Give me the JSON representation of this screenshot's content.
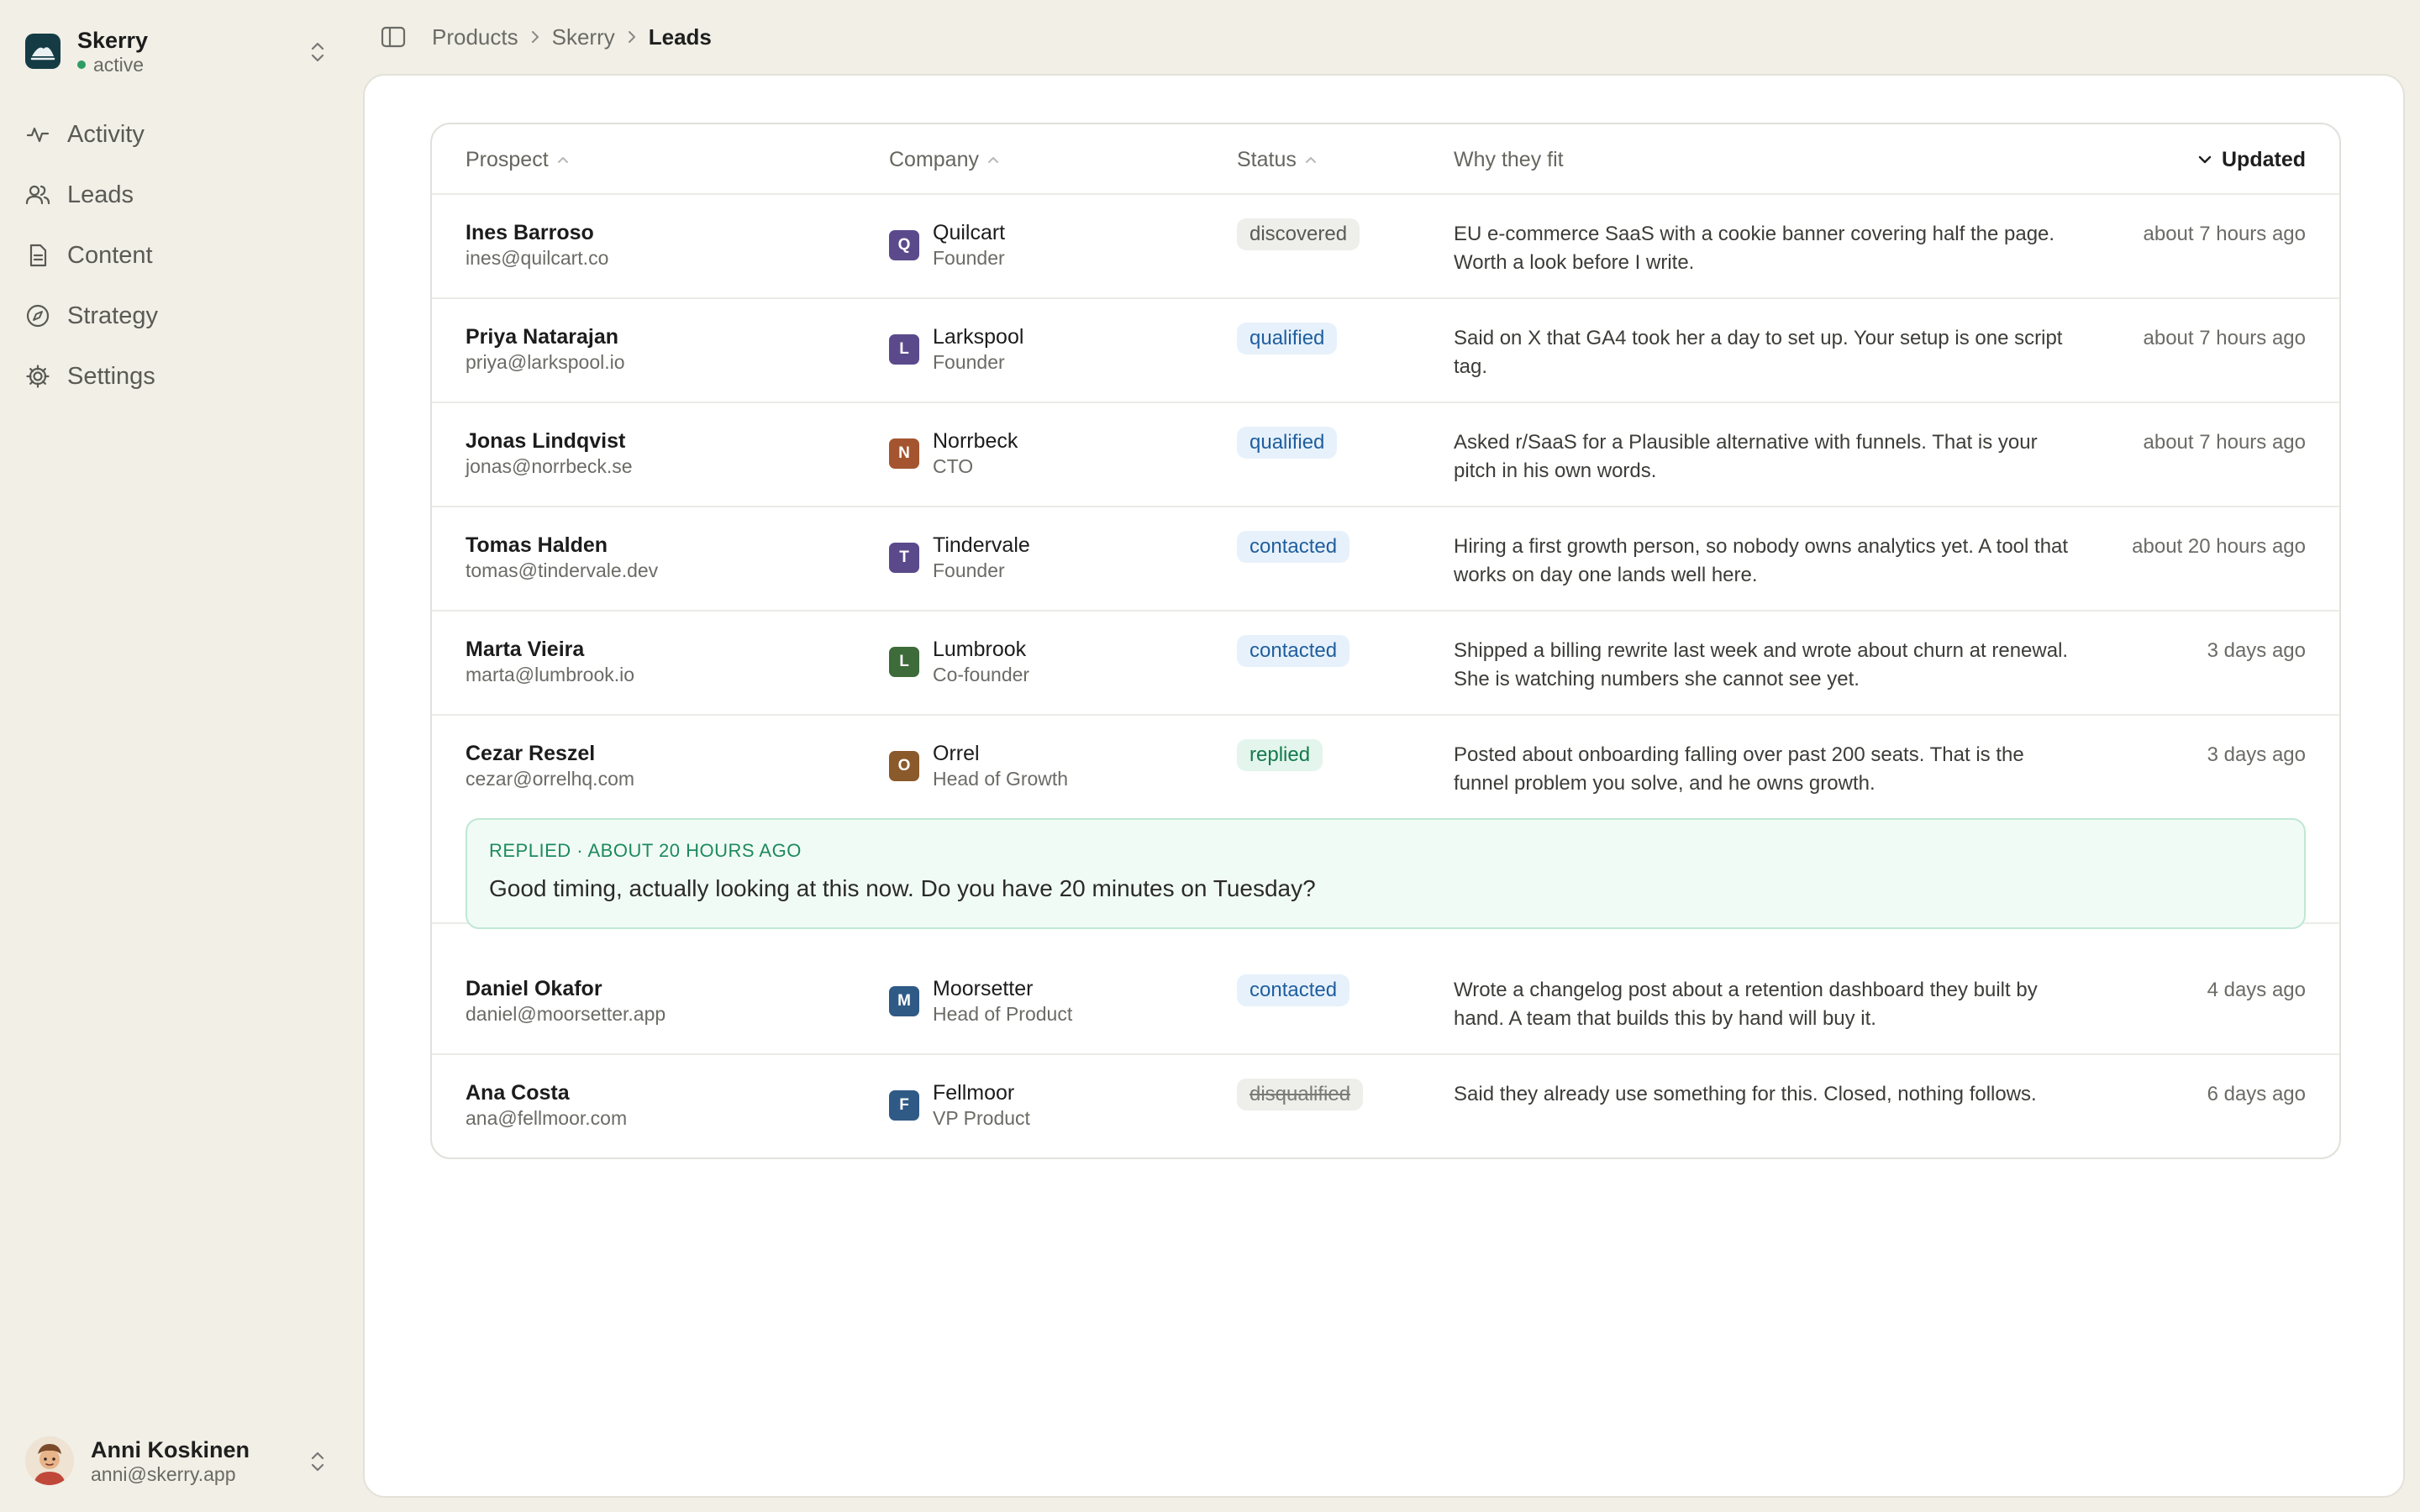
{
  "workspace": {
    "name": "Skerry",
    "status": "active"
  },
  "nav": [
    {
      "label": "Activity",
      "icon": "activity-icon"
    },
    {
      "label": "Leads",
      "icon": "users-icon"
    },
    {
      "label": "Content",
      "icon": "document-icon"
    },
    {
      "label": "Strategy",
      "icon": "compass-icon"
    },
    {
      "label": "Settings",
      "icon": "gear-icon"
    }
  ],
  "user": {
    "name": "Anni Koskinen",
    "email": "anni@skerry.app"
  },
  "breadcrumb": [
    "Products",
    "Skerry",
    "Leads"
  ],
  "table": {
    "headers": {
      "prospect": "Prospect",
      "company": "Company",
      "status": "Status",
      "why": "Why they fit",
      "updated": "Updated"
    },
    "rows": [
      {
        "name": "Ines Barroso",
        "email": "ines@quilcart.co",
        "company": "Quilcart",
        "initial": "Q",
        "logo_color": "#5b4a8b",
        "role": "Founder",
        "status": "discovered",
        "why": "EU e-commerce SaaS with a cookie banner covering half the page. Worth a look before I write.",
        "updated": "about 7 hours ago"
      },
      {
        "name": "Priya Natarajan",
        "email": "priya@larkspool.io",
        "company": "Larkspool",
        "initial": "L",
        "logo_color": "#5b4a8b",
        "role": "Founder",
        "status": "qualified",
        "why": "Said on X that GA4 took her a day to set up. Your setup is one script tag.",
        "updated": "about 7 hours ago"
      },
      {
        "name": "Jonas Lindqvist",
        "email": "jonas@norrbeck.se",
        "company": "Norrbeck",
        "initial": "N",
        "logo_color": "#a4552f",
        "role": "CTO",
        "status": "qualified",
        "why": "Asked r/SaaS for a Plausible alternative with funnels. That is your pitch in his own words.",
        "updated": "about 7 hours ago"
      },
      {
        "name": "Tomas Halden",
        "email": "tomas@tindervale.dev",
        "company": "Tindervale",
        "initial": "T",
        "logo_color": "#5b4a8b",
        "role": "Founder",
        "status": "contacted",
        "why": "Hiring a first growth person, so nobody owns analytics yet. A tool that works on day one lands well here.",
        "updated": "about 20 hours ago"
      },
      {
        "name": "Marta Vieira",
        "email": "marta@lumbrook.io",
        "company": "Lumbrook",
        "initial": "L",
        "logo_color": "#3d6b3a",
        "role": "Co-founder",
        "status": "contacted",
        "why": "Shipped a billing rewrite last week and wrote about churn at renewal. She is watching numbers she cannot see yet.",
        "updated": "3 days ago"
      },
      {
        "name": "Cezar Reszel",
        "email": "cezar@orrelhq.com",
        "company": "Orrel",
        "initial": "O",
        "logo_color": "#8a5a2b",
        "role": "Head of Growth",
        "status": "replied",
        "why": "Posted about onboarding falling over past 200 seats. That is the funnel problem you solve, and he owns growth.",
        "updated": "3 days ago"
      },
      {
        "name": "Daniel Okafor",
        "email": "daniel@moorsetter.app",
        "company": "Moorsetter",
        "initial": "M",
        "logo_color": "#2f5a86",
        "role": "Head of Product",
        "status": "contacted",
        "why": "Wrote a changelog post about a retention dashboard they built by hand. A team that builds this by hand will buy it.",
        "updated": "4 days ago"
      },
      {
        "name": "Ana Costa",
        "email": "ana@fellmoor.com",
        "company": "Fellmoor",
        "initial": "F",
        "logo_color": "#2f5a86",
        "role": "VP Product",
        "status": "disqualified",
        "why": "Said they already use something for this. Closed, nothing follows.",
        "updated": "6 days ago"
      }
    ],
    "reply": {
      "label": "REPLIED · ABOUT 20 HOURS AGO",
      "text": "Good timing, actually looking at this now. Do you have 20 minutes on Tuesday?"
    }
  },
  "colors": {
    "accent_green": "#1d8a5c",
    "badge_blue": "#1f5e9e",
    "sidebar_bg": "#f1efe6"
  }
}
